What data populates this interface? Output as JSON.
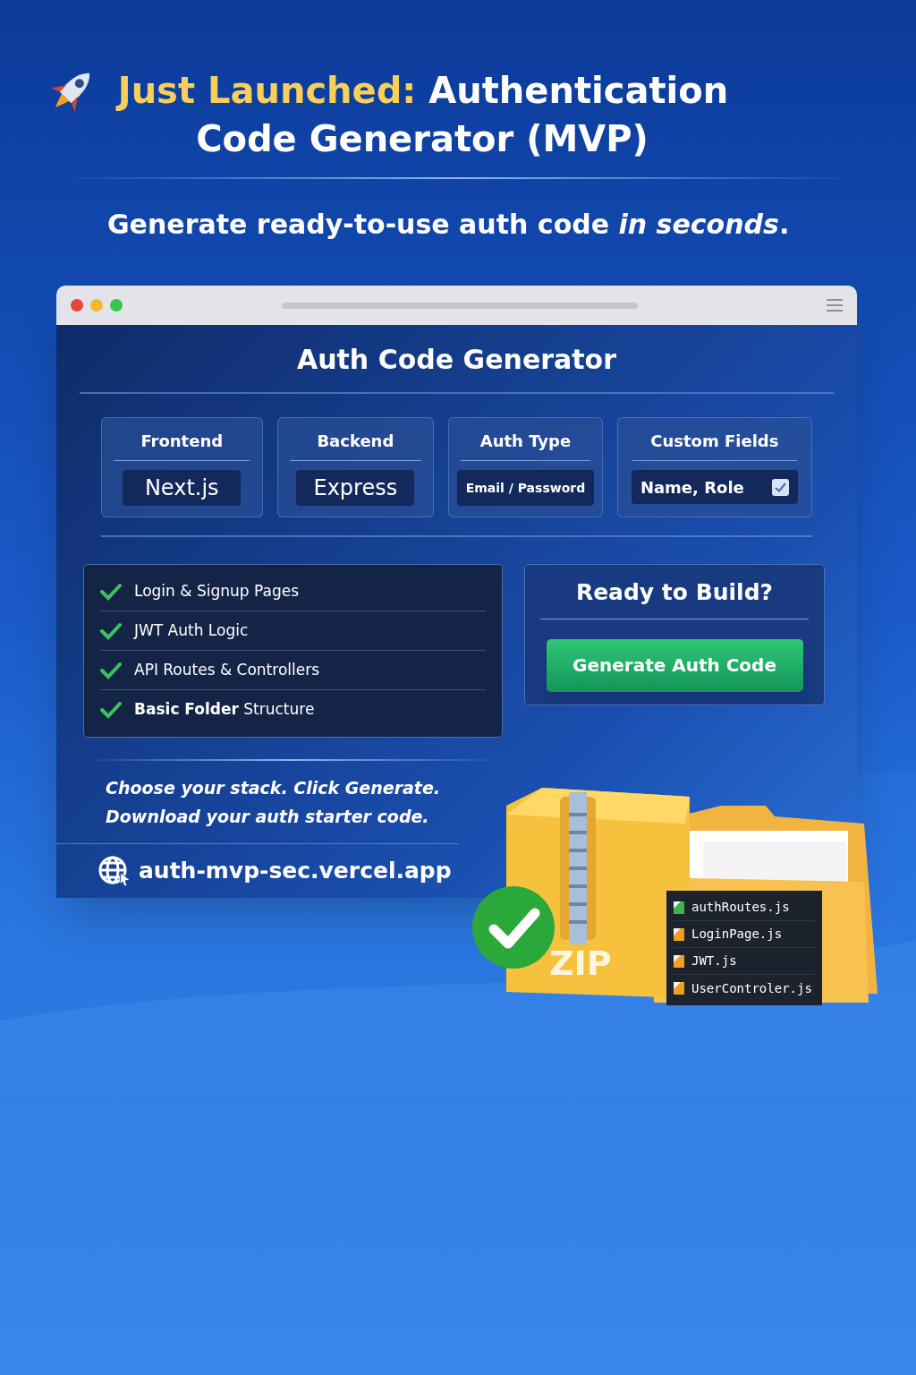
{
  "headline": {
    "highlight": "Just Launched:",
    "line_1": "Authentication",
    "line_2": "Code Generator (MVP)"
  },
  "subtitle": "Generate ready-to-use auth code *in seconds*.",
  "window": {
    "title": "Auth Code Generator",
    "options": [
      {
        "label": "Frontend",
        "value": "Next.js",
        "kind": "select"
      },
      {
        "label": "Backend",
        "value": "Express",
        "kind": "select"
      },
      {
        "label": "Auth Type",
        "value": "Email / Password",
        "kind": "select"
      },
      {
        "label": "Custom Fields",
        "value": "Name, Role",
        "kind": "checkbox",
        "checked": true
      }
    ],
    "features": [
      {
        "text": "Login & Signup Pages",
        "checked": true
      },
      {
        "text": "JWT Auth Logic",
        "checked": true
      },
      {
        "text": "API Routes & Controllers",
        "checked": true
      },
      {
        "text": "**Basic Folder** Structure",
        "checked": true
      }
    ],
    "cta": {
      "heading": "Ready to Build?",
      "button": "Generate Auth Code"
    },
    "tagline": [
      "Choose your stack. Click Generate.",
      "Download your auth starter code."
    ],
    "url": "auth-mvp-sec.vercel.app"
  },
  "archive": {
    "label": "ZIP",
    "files": [
      {
        "name": "authRoutes.js",
        "color": "#3cb44a"
      },
      {
        "name": "LoginPage.js",
        "color": "#f0a020"
      },
      {
        "name": "JWT.js",
        "color": "#f0a020"
      },
      {
        "name": "UserControler.js",
        "color": "#f0a020"
      }
    ]
  }
}
